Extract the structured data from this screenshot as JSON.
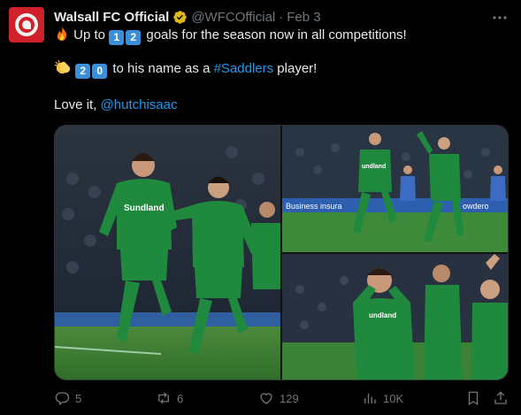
{
  "tweet": {
    "author_name": "Walsall FC Official",
    "handle": "@WFCOfficial",
    "separator": "·",
    "date": "Feb 3",
    "line1": {
      "emoji": "fire-emoji",
      "prefix": "Up to",
      "digits": [
        "1",
        "2"
      ],
      "suffix": "goals for the season now in all competitions!"
    },
    "line2": {
      "emoji": "clapping-hands-emoji",
      "digits": [
        "2",
        "0"
      ],
      "middle": "to his name as a",
      "hashtag": "#Saddlers",
      "suffix": "player!"
    },
    "line3": {
      "prefix": "Love it,",
      "mention": "@hutchisaac"
    }
  },
  "media": {
    "photos": [
      {
        "kit_text": "Sundland"
      },
      {
        "kit_text": "undland",
        "ad_text": "Business insura",
        "ad_text2": "owdero"
      },
      {
        "kit_text": "undland"
      }
    ]
  },
  "actions": {
    "replies": "5",
    "reposts": "6",
    "likes": "129",
    "views": "10K"
  },
  "colors": {
    "background": "#000000",
    "text": "#e7e9ea",
    "muted": "#71767b",
    "link": "#1d9bf0",
    "kit_green": "#1f8a3e",
    "pitch_green": "#3f8a3a"
  }
}
